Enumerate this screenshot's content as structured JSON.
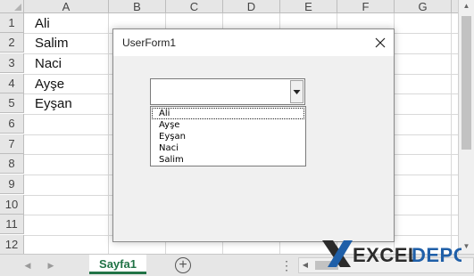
{
  "sheet": {
    "columns": [
      "A",
      "B",
      "C",
      "D",
      "E",
      "F",
      "G"
    ],
    "rows": [
      "1",
      "2",
      "3",
      "4",
      "5",
      "6",
      "7",
      "8",
      "9",
      "10",
      "11",
      "12"
    ],
    "cells_a": [
      "Ali",
      "Salim",
      "Naci",
      "Ayşe",
      "Eyşan"
    ]
  },
  "tabbar": {
    "sheet_tab": "Sayfa1",
    "add_sheet_symbol": "+",
    "menu_symbol": "⋮"
  },
  "userform": {
    "title": "UserForm1",
    "combobox_value": "",
    "dropdown_items": [
      "Ali",
      "Ayşe",
      "Eyşan",
      "Naci",
      "Salim"
    ]
  },
  "watermark": {
    "brand_prefix": "EXCEL",
    "brand_suffix": "DEPO"
  },
  "colors": {
    "accent_green": "#217346",
    "watermark_blue": "#1f5fa8",
    "watermark_dark": "#2b2b2b"
  }
}
